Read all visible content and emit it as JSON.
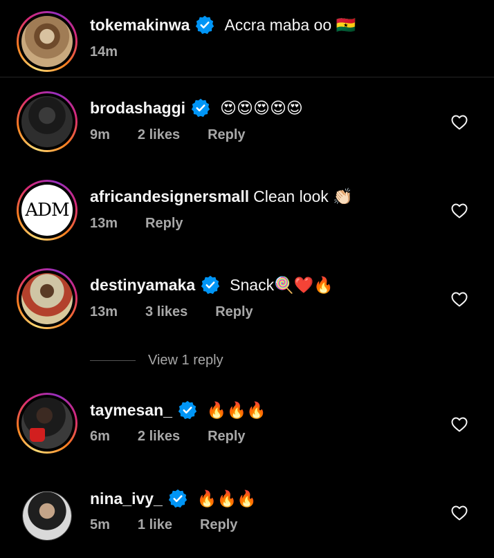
{
  "caption": {
    "username": "tokemakinwa",
    "text": "Accra maba oo 🇬🇭",
    "time": "14m"
  },
  "comments": [
    {
      "username": "brodashaggi",
      "verified": true,
      "text": "😍😍😍😍😍",
      "time": "9m",
      "likes": "2 likes",
      "reply": "Reply"
    },
    {
      "username": "africandesignersmall",
      "verified": false,
      "text": "Clean look 👏🏻",
      "time": "13m",
      "likes": "",
      "reply": "Reply",
      "avatar_text": "ADM"
    },
    {
      "username": "destinyamaka",
      "verified": true,
      "text": "Snack🍭❤️🔥",
      "time": "13m",
      "likes": "3 likes",
      "reply": "Reply"
    },
    {
      "username": "taymesan_",
      "verified": true,
      "text": "🔥🔥🔥",
      "time": "6m",
      "likes": "2 likes",
      "reply": "Reply"
    },
    {
      "username": "nina_ivy_",
      "verified": true,
      "text": "🔥🔥🔥",
      "time": "5m",
      "likes": "1 like",
      "reply": "Reply"
    }
  ],
  "view_replies": "View 1 reply",
  "colors": {
    "background": "#000000",
    "primary_text": "#f5f5f5",
    "secondary_text": "#a8a8a8",
    "verified_badge": "#0095f6"
  },
  "icons": {
    "verified": "verified-badge-icon",
    "like": "heart-outline-icon"
  }
}
